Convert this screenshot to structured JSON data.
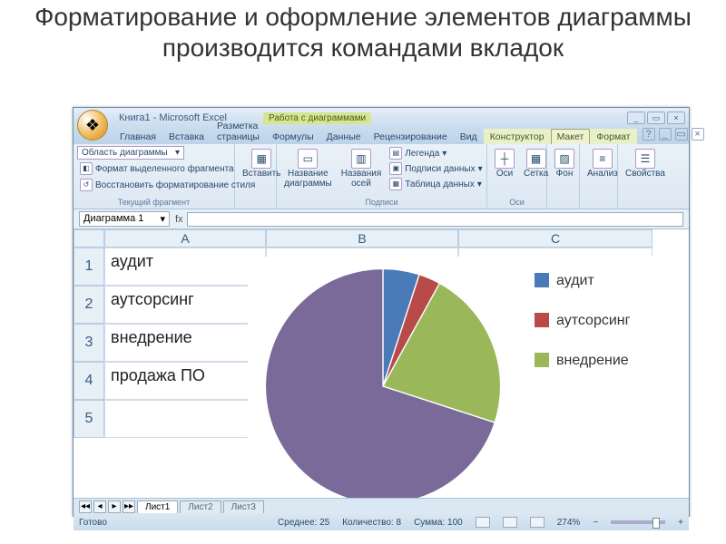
{
  "slide_title": "Форматирование и оформление элементов диаграммы производится командами вкладок",
  "window": {
    "title": "Книга1 - Microsoft Excel",
    "chart_tools": "Работа с диаграммами",
    "office_glyph": "❖",
    "min": "_",
    "restore": "▭",
    "close": "×"
  },
  "tabs": {
    "home": "Главная",
    "insert": "Вставка",
    "page_layout": "Разметка страницы",
    "formulas": "Формулы",
    "data": "Данные",
    "review": "Рецензирование",
    "view": "Вид",
    "design": "Конструктор",
    "layout": "Макет",
    "format": "Формат"
  },
  "ribbon": {
    "current_sel": {
      "dropdown": "Область диаграммы",
      "dd_arrow": "▾",
      "format_sel": "Формат выделенного фрагмента",
      "reset": "Восстановить форматирование стиля",
      "group": "Текущий фрагмент"
    },
    "insert": "Вставить",
    "labels": {
      "chart_title": "Название диаграммы",
      "axis_titles": "Названия осей",
      "legend": "Легенда",
      "data_labels": "Подписи данных",
      "data_table": "Таблица данных",
      "group": "Подписи"
    },
    "axes": {
      "axes": "Оси",
      "grid": "Сетка",
      "group": "Оси"
    },
    "bg": {
      "bg": "Фон"
    },
    "analysis": {
      "analysis": "Анализ"
    },
    "properties": {
      "props": "Свойства"
    },
    "help": "?"
  },
  "formula_bar": {
    "name_box": "Диаграмма 1",
    "arrow": "▾",
    "fx": "fx"
  },
  "columns": {
    "A": "A",
    "B": "B",
    "C": "C"
  },
  "rows": {
    "r1": "1",
    "r2": "2",
    "r3": "3",
    "r4": "4",
    "r5": "5"
  },
  "cells": {
    "A1": "аудит",
    "A2": "аутсорсинг",
    "A3": "внедрение",
    "A4": "продажа ПО",
    "A5": ""
  },
  "legend": {
    "i1": "аудит",
    "i2": "аутсорсинг",
    "i3": "внедрение"
  },
  "colors": {
    "audit": "#4a7ab8",
    "outsourcing": "#b84a4a",
    "implementation": "#9ab85a",
    "sale": "#7a6a9a"
  },
  "sheet_tabs": {
    "prev2": "◂◂",
    "prev": "◂",
    "next": "▸",
    "next2": "▸▸",
    "s1": "Лист1",
    "s2": "Лист2",
    "s3": "Лист3"
  },
  "status": {
    "ready": "Готово",
    "avg_lbl": "Среднее:",
    "avg": "25",
    "count_lbl": "Количество:",
    "count": "8",
    "sum_lbl": "Сумма:",
    "sum": "100",
    "zoom": "274%",
    "minus": "−",
    "plus": "+"
  },
  "chart_data": {
    "type": "pie",
    "categories": [
      "аудит",
      "аутсорсинг",
      "внедрение",
      "продажа ПО"
    ],
    "values": [
      5,
      3,
      22,
      70
    ],
    "colors": [
      "#4a7ab8",
      "#b84a4a",
      "#9ab85a",
      "#7a6a9a"
    ]
  }
}
